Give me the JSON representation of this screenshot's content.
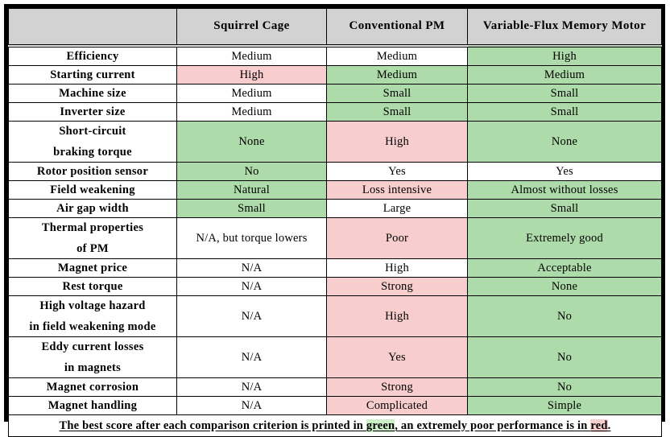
{
  "table": {
    "columns": [
      {
        "key": "criterion",
        "label": ""
      },
      {
        "key": "squirrel_cage",
        "label": "Squirrel Cage"
      },
      {
        "key": "conventional_pm",
        "label": "Conventional PM"
      },
      {
        "key": "variable_flux",
        "label": "Variable-Flux Memory Motor"
      }
    ],
    "rows": [
      {
        "criterion": "Efficiency",
        "criterion_lines": [
          "Efficiency"
        ],
        "cells": [
          {
            "text": "Medium",
            "status": "none"
          },
          {
            "text": "Medium",
            "status": "none"
          },
          {
            "text": "High",
            "status": "green"
          }
        ]
      },
      {
        "criterion": "Starting current",
        "criterion_lines": [
          "Starting current"
        ],
        "cells": [
          {
            "text": "High",
            "status": "red"
          },
          {
            "text": "Medium",
            "status": "green"
          },
          {
            "text": "Medium",
            "status": "green"
          }
        ]
      },
      {
        "criterion": "Machine size",
        "criterion_lines": [
          "Machine size"
        ],
        "cells": [
          {
            "text": "Medium",
            "status": "none"
          },
          {
            "text": "Small",
            "status": "green"
          },
          {
            "text": "Small",
            "status": "green"
          }
        ]
      },
      {
        "criterion": "Inverter size",
        "criterion_lines": [
          "Inverter size"
        ],
        "cells": [
          {
            "text": "Medium",
            "status": "none"
          },
          {
            "text": "Small",
            "status": "green"
          },
          {
            "text": "Small",
            "status": "green"
          }
        ]
      },
      {
        "criterion": "Short-circuit braking torque",
        "criterion_lines": [
          "Short-circuit",
          "braking torque"
        ],
        "cells": [
          {
            "text": "None",
            "status": "green"
          },
          {
            "text": "High",
            "status": "red"
          },
          {
            "text": "None",
            "status": "green"
          }
        ]
      },
      {
        "criterion": "Rotor position sensor",
        "criterion_lines": [
          "Rotor position sensor"
        ],
        "cells": [
          {
            "text": "No",
            "status": "green"
          },
          {
            "text": "Yes",
            "status": "none"
          },
          {
            "text": "Yes",
            "status": "none"
          }
        ]
      },
      {
        "criterion": "Field weakening",
        "criterion_lines": [
          "Field weakening"
        ],
        "cells": [
          {
            "text": "Natural",
            "status": "green"
          },
          {
            "text": "Loss intensive",
            "status": "red"
          },
          {
            "text": "Almost without losses",
            "status": "green"
          }
        ]
      },
      {
        "criterion": "Air gap width",
        "criterion_lines": [
          "Air gap width"
        ],
        "cells": [
          {
            "text": "Small",
            "status": "green"
          },
          {
            "text": "Large",
            "status": "none"
          },
          {
            "text": "Small",
            "status": "green"
          }
        ]
      },
      {
        "criterion": "Thermal properties of PM",
        "criterion_lines": [
          "Thermal properties",
          "of PM"
        ],
        "cells": [
          {
            "text": "N/A, but torque lowers",
            "status": "none"
          },
          {
            "text": "Poor",
            "status": "red"
          },
          {
            "text": "Extremely good",
            "status": "green"
          }
        ]
      },
      {
        "criterion": "Magnet price",
        "criterion_lines": [
          "Magnet price"
        ],
        "cells": [
          {
            "text": "N/A",
            "status": "none"
          },
          {
            "text": "High",
            "status": "none"
          },
          {
            "text": "Acceptable",
            "status": "green"
          }
        ]
      },
      {
        "criterion": "Rest torque",
        "criterion_lines": [
          "Rest torque"
        ],
        "cells": [
          {
            "text": "N/A",
            "status": "none"
          },
          {
            "text": "Strong",
            "status": "red"
          },
          {
            "text": "None",
            "status": "green"
          }
        ]
      },
      {
        "criterion": "High voltage hazard in field weakening mode",
        "criterion_lines": [
          "High voltage hazard",
          "in field weakening mode"
        ],
        "cells": [
          {
            "text": "N/A",
            "status": "none"
          },
          {
            "text": "High",
            "status": "red"
          },
          {
            "text": "No",
            "status": "green"
          }
        ]
      },
      {
        "criterion": "Eddy current losses in magnets",
        "criterion_lines": [
          "Eddy current losses",
          "in magnets"
        ],
        "cells": [
          {
            "text": "N/A",
            "status": "none"
          },
          {
            "text": "Yes",
            "status": "red"
          },
          {
            "text": "No",
            "status": "green"
          }
        ]
      },
      {
        "criterion": "Magnet corrosion",
        "criterion_lines": [
          "Magnet corrosion"
        ],
        "cells": [
          {
            "text": "N/A",
            "status": "none"
          },
          {
            "text": "Strong",
            "status": "red"
          },
          {
            "text": "No",
            "status": "green"
          }
        ]
      },
      {
        "criterion": "Magnet handling",
        "criterion_lines": [
          "Magnet handling"
        ],
        "cells": [
          {
            "text": "N/A",
            "status": "none"
          },
          {
            "text": "Complicated",
            "status": "red"
          },
          {
            "text": "Simple",
            "status": "green"
          }
        ]
      }
    ],
    "note": {
      "part1": "The best score after each comparison criterion is printed in ",
      "green_word": "green",
      "part2": ", an extremely poor performance is in ",
      "red_word": "red",
      "part3": "."
    }
  },
  "colors": {
    "good": "#aedbaa",
    "bad": "#f8cdcd",
    "header_bg": "#d2d2d2",
    "border": "#000000",
    "note_green_highlight": "#cdf0c8",
    "note_red_highlight": "#f8cdcd"
  }
}
